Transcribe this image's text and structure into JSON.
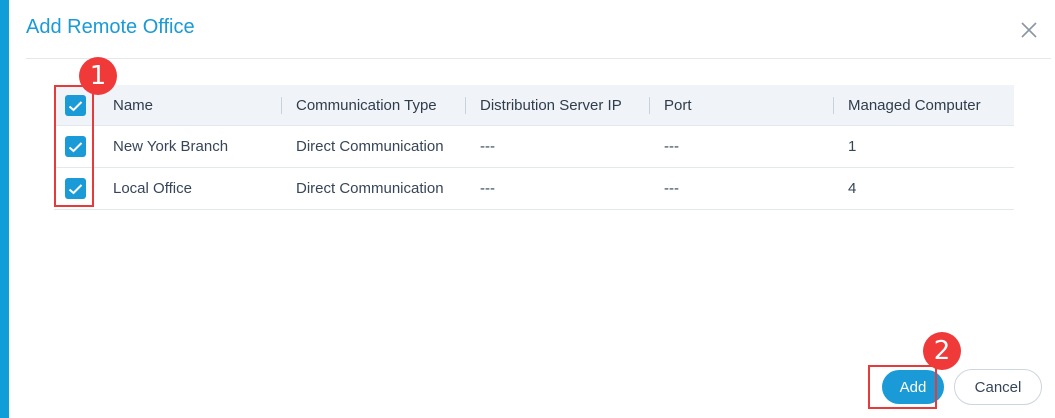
{
  "dialog": {
    "title": "Add Remote Office",
    "add_label": "Add",
    "cancel_label": "Cancel"
  },
  "table": {
    "columns": [
      "Name",
      "Communication Type",
      "Distribution Server IP",
      "Port",
      "Managed Computer"
    ],
    "rows": [
      {
        "checked": true,
        "name": "New York Branch",
        "type": "Direct Communication",
        "ip": "---",
        "port": "---",
        "computers": "1"
      },
      {
        "checked": true,
        "name": "Local Office",
        "type": "Direct Communication",
        "ip": "---",
        "port": "---",
        "computers": "4"
      }
    ],
    "select_all_checked": true
  },
  "annotations": {
    "step1": "1",
    "step2": "2"
  },
  "colors": {
    "accent": "#1a9ad6",
    "highlight": "#e53b3b",
    "badge": "#f03a3a"
  },
  "icons": {
    "close": "close-icon",
    "check": "checkmark-icon"
  }
}
